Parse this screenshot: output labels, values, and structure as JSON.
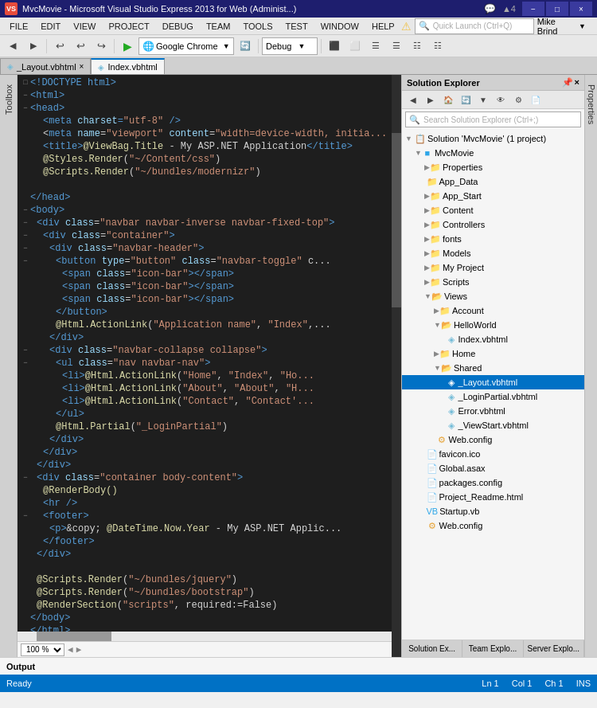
{
  "titleBar": {
    "title": "MvcMovie - Microsoft Visual Studio Express 2013 for Web (Administ...)",
    "logo": "VS",
    "controls": [
      "−",
      "□",
      "×"
    ]
  },
  "menuBar": {
    "items": [
      "FILE",
      "EDIT",
      "VIEW",
      "PROJECT",
      "DEBUG",
      "TEAM",
      "TOOLS",
      "TEST",
      "WINDOW",
      "HELP"
    ]
  },
  "toolbar": {
    "browserLabel": "Google Chrome",
    "debugLabel": "Debug",
    "quickLaunchPlaceholder": "Quick Launch (Ctrl+Q)",
    "userLabel": "Mike Brind"
  },
  "tabs": [
    {
      "label": "_Layout.vbhtml",
      "active": false
    },
    {
      "label": "Index.vbhtml",
      "active": true
    }
  ],
  "editor": {
    "lines": [
      {
        "num": "",
        "indent": 0,
        "code": "<!DOCTYPE html>"
      },
      {
        "num": "",
        "indent": 0,
        "code": "<html>"
      },
      {
        "num": "",
        "indent": 0,
        "code": "<head>"
      },
      {
        "num": "",
        "indent": 4,
        "code": "<meta charset=\"utf-8\" />"
      },
      {
        "num": "",
        "indent": 4,
        "code": "<meta name=\"viewport\" content=\"width=device-width, initia..."
      },
      {
        "num": "",
        "indent": 4,
        "code": "<title>@ViewBag.Title - My ASP.NET Application</title>"
      },
      {
        "num": "",
        "indent": 4,
        "code": "@Styles.Render(\"~/Content/css\")"
      },
      {
        "num": "",
        "indent": 4,
        "code": "@Scripts.Render(\"~/bundles/modernizr\")"
      },
      {
        "num": "",
        "indent": 0,
        "code": ""
      },
      {
        "num": "",
        "indent": 0,
        "code": "</head>"
      },
      {
        "num": "",
        "indent": 0,
        "code": "<body>"
      },
      {
        "num": "",
        "indent": 4,
        "code": "<div class=\"navbar navbar-inverse navbar-fixed-top\">"
      },
      {
        "num": "",
        "indent": 8,
        "code": "<div class=\"container\">"
      },
      {
        "num": "",
        "indent": 12,
        "code": "<div class=\"navbar-header\">"
      },
      {
        "num": "",
        "indent": 16,
        "code": "<button type=\"button\" class=\"navbar-toggle\" c..."
      },
      {
        "num": "",
        "indent": 20,
        "code": "<span class=\"icon-bar\"></span>"
      },
      {
        "num": "",
        "indent": 20,
        "code": "<span class=\"icon-bar\"></span>"
      },
      {
        "num": "",
        "indent": 20,
        "code": "<span class=\"icon-bar\"></span>"
      },
      {
        "num": "",
        "indent": 16,
        "code": "</button>"
      },
      {
        "num": "",
        "indent": 16,
        "code": "@Html.ActionLink(\"Application name\", \"Index\",..."
      },
      {
        "num": "",
        "indent": 12,
        "code": "</div>"
      },
      {
        "num": "",
        "indent": 12,
        "code": "<div class=\"navbar-collapse collapse\">"
      },
      {
        "num": "",
        "indent": 16,
        "code": "<ul class=\"nav navbar-nav\">"
      },
      {
        "num": "",
        "indent": 20,
        "code": "<li>@Html.ActionLink(\"Home\", \"Index\", \"Ho..."
      },
      {
        "num": "",
        "indent": 20,
        "code": "<li>@Html.ActionLink(\"About\", \"About\", \"H..."
      },
      {
        "num": "",
        "indent": 20,
        "code": "<li>@Html.ActionLink(\"Contact\", \"Contact'..."
      },
      {
        "num": "",
        "indent": 16,
        "code": "</ul>"
      },
      {
        "num": "",
        "indent": 16,
        "code": "@Html.Partial(\"_LoginPartial\")"
      },
      {
        "num": "",
        "indent": 12,
        "code": "</div>"
      },
      {
        "num": "",
        "indent": 8,
        "code": "</div>"
      },
      {
        "num": "",
        "indent": 4,
        "code": "</div>"
      },
      {
        "num": "",
        "indent": 4,
        "code": "<div class=\"container body-content\">"
      },
      {
        "num": "",
        "indent": 8,
        "code": "@RenderBody()"
      },
      {
        "num": "",
        "indent": 8,
        "code": "<hr />"
      },
      {
        "num": "",
        "indent": 8,
        "code": "<footer>"
      },
      {
        "num": "",
        "indent": 12,
        "code": "<p>&copy; @DateTime.Now.Year - My ASP.NET Applic..."
      },
      {
        "num": "",
        "indent": 8,
        "code": "</footer>"
      },
      {
        "num": "",
        "indent": 4,
        "code": "</div>"
      },
      {
        "num": "",
        "indent": 0,
        "code": ""
      },
      {
        "num": "",
        "indent": 4,
        "code": "@Scripts.Render(\"~/bundles/jquery\")"
      },
      {
        "num": "",
        "indent": 4,
        "code": "@Scripts.Render(\"~/bundles/bootstrap\")"
      },
      {
        "num": "",
        "indent": 4,
        "code": "@RenderSection(\"scripts\", required:=False)"
      },
      {
        "num": "",
        "indent": 0,
        "code": "</body>"
      },
      {
        "num": "",
        "indent": 0,
        "code": "</html>"
      }
    ],
    "zoomLevel": "100 %",
    "statusLine": "Ln 1",
    "statusCol": "Col 1",
    "statusCh": "Ch 1",
    "statusMode": "INS"
  },
  "solutionExplorer": {
    "title": "Solution Explorer",
    "searchPlaceholder": "Search Solution Explorer (Ctrl+;)",
    "tree": {
      "solution": "Solution 'MvcMovie' (1 project)",
      "project": "MvcMovie",
      "items": [
        {
          "label": "Properties",
          "type": "folder",
          "level": 2
        },
        {
          "label": "App_Data",
          "type": "folder",
          "level": 2
        },
        {
          "label": "App_Start",
          "type": "folder",
          "level": 2,
          "collapsed": true
        },
        {
          "label": "Content",
          "type": "folder",
          "level": 2,
          "collapsed": true
        },
        {
          "label": "Controllers",
          "type": "folder",
          "level": 2,
          "collapsed": true
        },
        {
          "label": "fonts",
          "type": "folder",
          "level": 2,
          "collapsed": true
        },
        {
          "label": "Models",
          "type": "folder",
          "level": 2,
          "collapsed": true
        },
        {
          "label": "My Project",
          "type": "folder",
          "level": 2,
          "collapsed": true
        },
        {
          "label": "Scripts",
          "type": "folder",
          "level": 2,
          "collapsed": true
        },
        {
          "label": "Views",
          "type": "folder",
          "level": 2,
          "expanded": true
        },
        {
          "label": "Account",
          "type": "folder",
          "level": 3,
          "collapsed": true
        },
        {
          "label": "HelloWorld",
          "type": "folder",
          "level": 3,
          "expanded": true
        },
        {
          "label": "Index.vbhtml",
          "type": "vbhtml",
          "level": 4
        },
        {
          "label": "Home",
          "type": "folder",
          "level": 3,
          "collapsed": true
        },
        {
          "label": "Shared",
          "type": "folder",
          "level": 3,
          "expanded": true
        },
        {
          "label": "_Layout.vbhtml",
          "type": "vbhtml",
          "level": 4,
          "selected": true
        },
        {
          "label": "_LoginPartial.vbhtml",
          "type": "vbhtml",
          "level": 4
        },
        {
          "label": "Error.vbhtml",
          "type": "vbhtml",
          "level": 4
        },
        {
          "label": "_ViewStart.vbhtml",
          "type": "vbhtml",
          "level": 4
        },
        {
          "label": "Web.config",
          "type": "config",
          "level": 3
        },
        {
          "label": "favicon.ico",
          "type": "file",
          "level": 2
        },
        {
          "label": "Global.asax",
          "type": "file",
          "level": 2
        },
        {
          "label": "packages.config",
          "type": "file",
          "level": 2
        },
        {
          "label": "Project_Readme.html",
          "type": "file",
          "level": 2
        },
        {
          "label": "Startup.vb",
          "type": "vb",
          "level": 2
        },
        {
          "label": "Web.config",
          "type": "config",
          "level": 2
        }
      ]
    },
    "tabs": [
      "Solution Ex...",
      "Team Explo...",
      "Server Explo..."
    ]
  },
  "outputPanel": {
    "label": "Output"
  },
  "statusBar": {
    "readyText": "Ready",
    "lineLabel": "Ln 1",
    "colLabel": "Col 1",
    "chLabel": "Ch 1",
    "modeLabel": "INS"
  }
}
